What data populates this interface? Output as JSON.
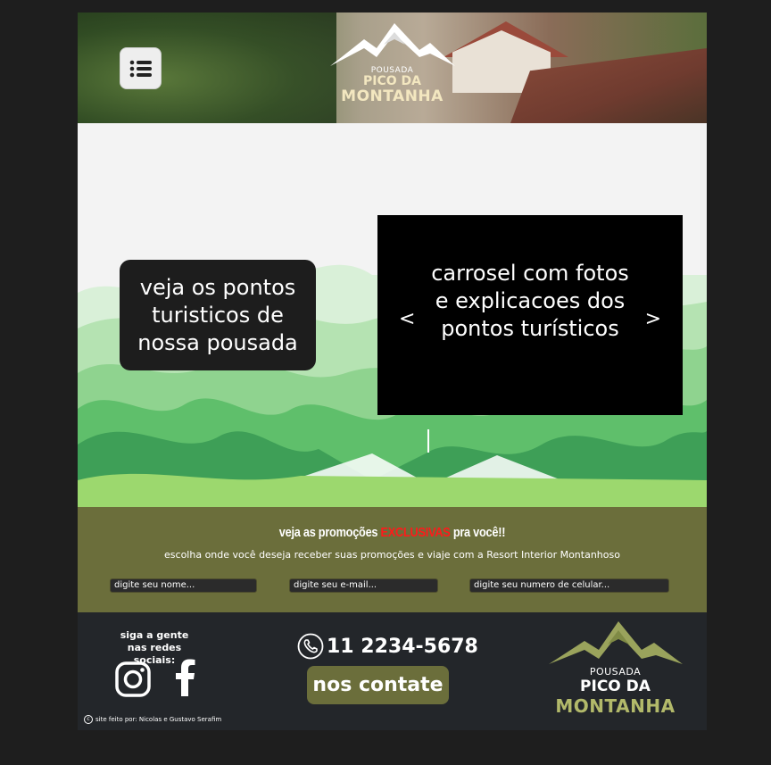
{
  "header": {
    "menu_icon": "list-menu-icon",
    "logo": {
      "pousada": "POUSADA",
      "pico": "PICO DA",
      "montanha": "MONTANHA"
    }
  },
  "main": {
    "tour_text": "veja os pontos turisticos de nossa pousada",
    "carousel": {
      "text": "carrosel com fotos e explicacoes dos pontos turísticos",
      "prev": "<",
      "next": ">"
    }
  },
  "promo": {
    "title_pre": "veja as promoções",
    "title_highlight": "EXCLUSIVAS",
    "title_post": "pra você!!",
    "subtitle": "escolha onde você deseja receber suas promoções e viaje com a Resort Interior Montanhoso",
    "fields": {
      "name_placeholder": "digite seu nome...",
      "email_placeholder": "digite seu e-mail...",
      "phone_placeholder": "digite seu numero de celular..."
    },
    "highlight_color": "#ff1a1a",
    "background_color": "#6b6e3b"
  },
  "footer": {
    "social_title": "siga a gente nas redes sociais:",
    "phone": "11 2234-5678",
    "contact_button": "nos contate",
    "credit": "site feito por: Nicolas e Gustavo Serafim",
    "logo": {
      "pousada": "POUSADA",
      "pico": "PICO DA",
      "montanha": "MONTANHA"
    },
    "icons": [
      "instagram-icon",
      "facebook-icon",
      "phone-icon"
    ]
  }
}
